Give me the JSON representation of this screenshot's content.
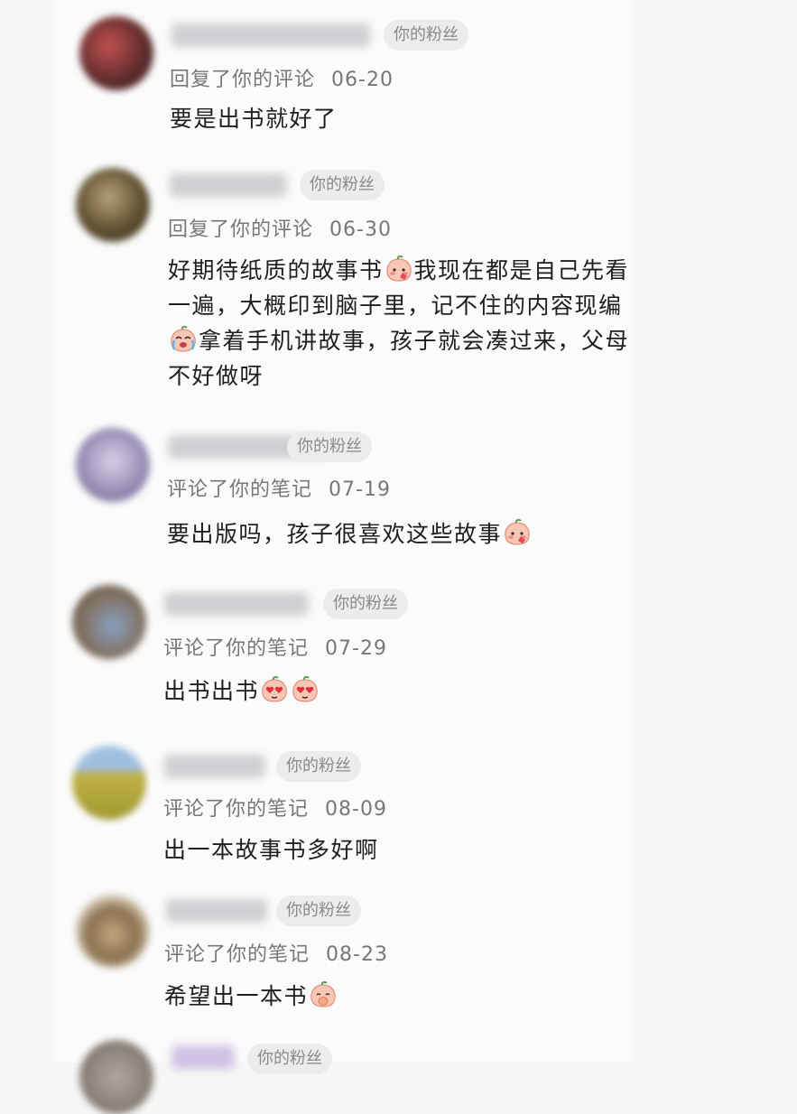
{
  "items": [
    {
      "badge": "你的粉丝",
      "action": "回复了你的评论",
      "date": "06-20",
      "content": [
        "要是出书就好了"
      ]
    },
    {
      "badge": "你的粉丝",
      "action": "回复了你的评论",
      "date": "06-30",
      "content": [
        "好期待纸质的故事书",
        "我现在都是自己先看",
        "一遍，大概印到脑子里，记不住的内容现编",
        "拿着手机讲故事，孩子就会凑过来，父母",
        "不好做呀"
      ]
    },
    {
      "badge": "你的粉丝",
      "action": "评论了你的笔记",
      "date": "07-19",
      "content": [
        "要出版吗，孩子很喜欢这些故事"
      ]
    },
    {
      "badge": "你的粉丝",
      "action": "评论了你的笔记",
      "date": "07-29",
      "content": [
        "出书出书"
      ]
    },
    {
      "badge": "你的粉丝",
      "action": "评论了你的笔记",
      "date": "08-09",
      "content": [
        "出一本故事书多好啊"
      ]
    },
    {
      "badge": "你的粉丝",
      "action": "评论了你的笔记",
      "date": "08-23",
      "content": [
        "希望出一本书"
      ]
    },
    {
      "badge": "你的粉丝"
    }
  ],
  "icons": {
    "emoji_blush": "peach-blush-emoji-icon",
    "emoji_cry": "peach-cry-emoji-icon",
    "emoji_hearteyes": "peach-heart-eyes-emoji-icon",
    "emoji_shy": "peach-shy-emoji-icon"
  },
  "colors": {
    "text": "#1e1e1e",
    "meta": "#777777",
    "badge_bg": "#ececec",
    "badge_text": "#8a8a8a"
  }
}
